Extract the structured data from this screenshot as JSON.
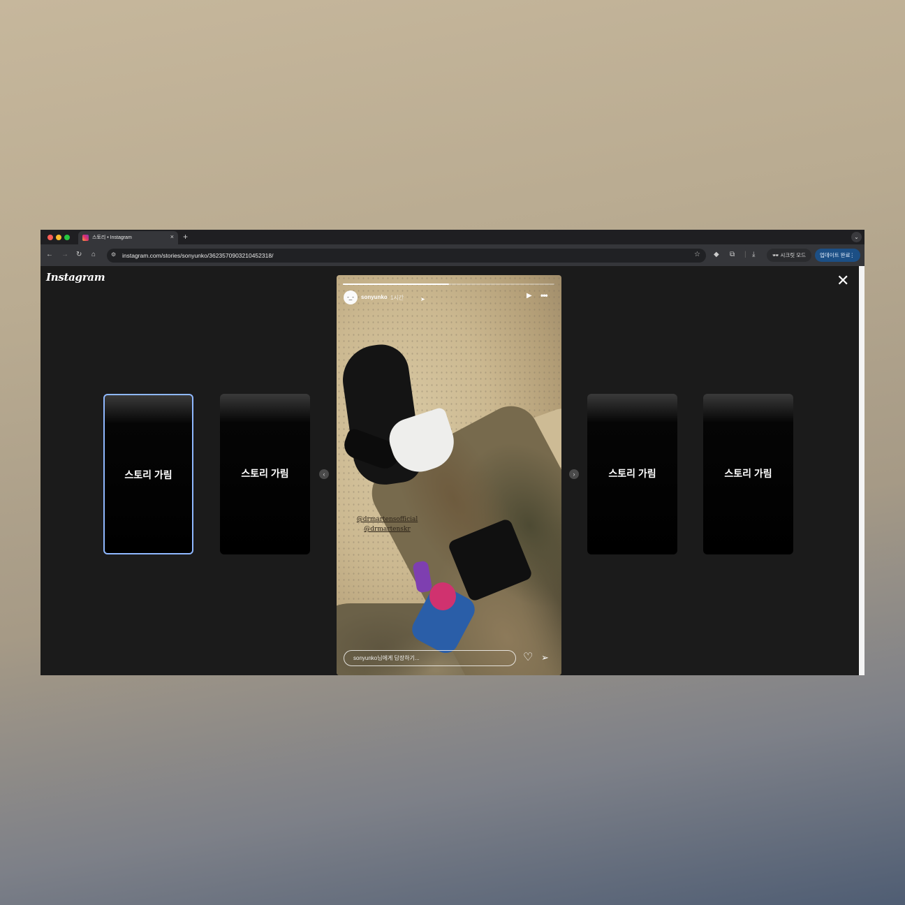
{
  "browser": {
    "tab_title": "스토리 • Instagram",
    "tab_close": "×",
    "new_tab": "+",
    "tab_menu": "⌄",
    "url": "instagram.com/stories/sonyunko/3623570903210452318/",
    "incognito_label": "시크릿 모드",
    "update_label": "업데이트 완료",
    "update_menu": "⋮",
    "icons": [
      "back-icon",
      "forward-icon",
      "reload-icon",
      "home-icon",
      "site-info-icon",
      "star-icon",
      "extension-icon",
      "puzzle-icon",
      "download-icon",
      "incognito-icon"
    ]
  },
  "page": {
    "logo": "Instagram",
    "close": "✕"
  },
  "side_stories": [
    {
      "label": "스토리 가림",
      "selected": true
    },
    {
      "label": "스토리 가림",
      "selected": false
    },
    {
      "label": "스토리 가림",
      "selected": false
    },
    {
      "label": "스토리 가림",
      "selected": false
    }
  ],
  "story": {
    "username": "sonyunko",
    "time": "1시간",
    "progress": 0.5,
    "mentions": [
      "@drmartensofficial",
      "@drmartenskr"
    ],
    "reply_placeholder": "sonyunko님에게 답장하기..."
  },
  "colors": {
    "background": "#1b1b1b",
    "selected_border": "#8fb8ff",
    "update_button": "#1c4f85"
  }
}
